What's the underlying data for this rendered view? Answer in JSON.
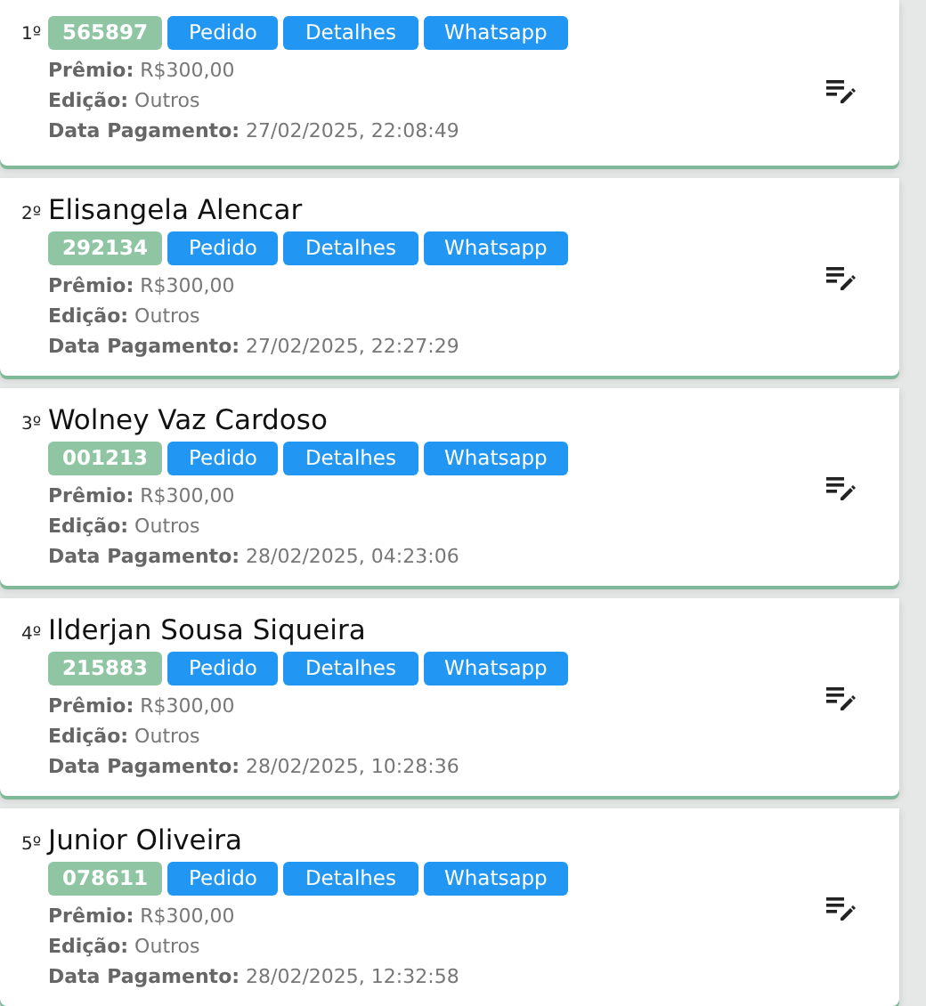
{
  "entries": [
    {
      "rank": "1º",
      "code": "565897",
      "buttons": [
        "Pedido",
        "Detalhes",
        "Whatsapp"
      ],
      "fields": [
        {
          "label": "Prêmio:",
          "value": "R$300,00"
        },
        {
          "label": "Edição:",
          "value": "Outros"
        },
        {
          "label": "Data Pagamento:",
          "value": "27/02/2025, 22:08:49"
        }
      ]
    },
    {
      "rank": "2º",
      "name": "Elisangela Alencar",
      "code": "292134",
      "buttons": [
        "Pedido",
        "Detalhes",
        "Whatsapp"
      ],
      "fields": [
        {
          "label": "Prêmio:",
          "value": "R$300,00"
        },
        {
          "label": "Edição:",
          "value": "Outros"
        },
        {
          "label": "Data Pagamento:",
          "value": "27/02/2025, 22:27:29"
        }
      ]
    },
    {
      "rank": "3º",
      "name": "Wolney Vaz Cardoso",
      "code": "001213",
      "buttons": [
        "Pedido",
        "Detalhes",
        "Whatsapp"
      ],
      "fields": [
        {
          "label": "Prêmio:",
          "value": "R$300,00"
        },
        {
          "label": "Edição:",
          "value": "Outros"
        },
        {
          "label": "Data Pagamento:",
          "value": "28/02/2025, 04:23:06"
        }
      ]
    },
    {
      "rank": "4º",
      "name": "Ilderjan Sousa Siqueira",
      "code": "215883",
      "buttons": [
        "Pedido",
        "Detalhes",
        "Whatsapp"
      ],
      "fields": [
        {
          "label": "Prêmio:",
          "value": "R$300,00"
        },
        {
          "label": "Edição:",
          "value": "Outros"
        },
        {
          "label": "Data Pagamento:",
          "value": "28/02/2025, 10:28:36"
        }
      ]
    },
    {
      "rank": "5º",
      "name": "Junior Oliveira",
      "code": "078611",
      "buttons": [
        "Pedido",
        "Detalhes",
        "Whatsapp"
      ],
      "fields": [
        {
          "label": "Prêmio:",
          "value": "R$300,00"
        },
        {
          "label": "Edição:",
          "value": "Outros"
        },
        {
          "label": "Data Pagamento:",
          "value": "28/02/2025, 12:32:58"
        }
      ]
    }
  ]
}
